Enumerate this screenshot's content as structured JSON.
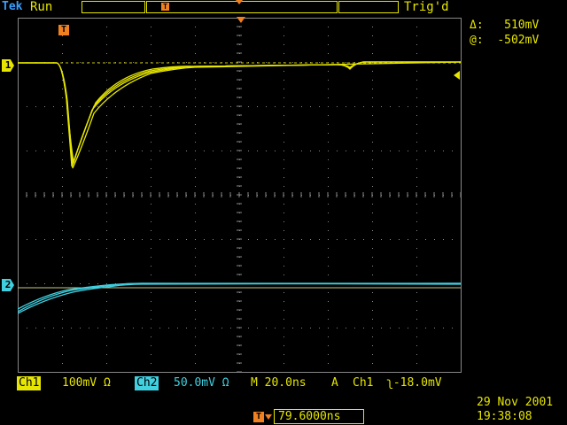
{
  "header": {
    "brand": "Tek",
    "acq_state": "Run",
    "trig_state": "Trig'd"
  },
  "cursors": {
    "delta_label": "Δ:",
    "delta_value": "510mV",
    "at_label": "@:",
    "at_value": "-502mV"
  },
  "markers": {
    "ch1": "1",
    "ch2": "2",
    "trigger": "T"
  },
  "status": {
    "ch1_label": "Ch1",
    "ch1_scale": "100mV Ω",
    "ch2_label": "Ch2",
    "ch2_scale": "50.0mV Ω",
    "horizontal": "M 20.0ns",
    "trig_mode": "A",
    "trig_source": "Ch1",
    "trig_level": "ʅ-18.0mV"
  },
  "trigger_position": "79.6000ns",
  "timestamp": {
    "date": "29 Nov 2001",
    "time": "19:38:08"
  },
  "colors": {
    "ch1": "#e6e600",
    "ch2": "#40d0e0",
    "trigger": "#f08020",
    "grid": "#888888"
  }
}
